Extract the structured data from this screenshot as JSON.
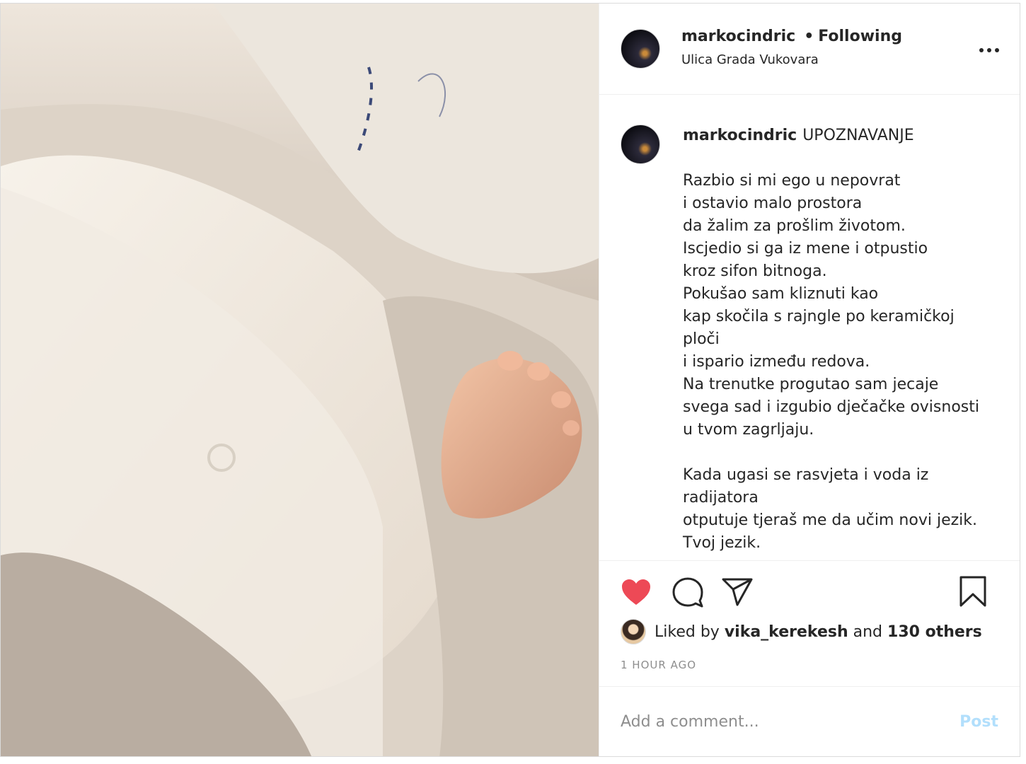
{
  "header": {
    "username": "markocindric",
    "separator": "•",
    "follow_status": "Following",
    "location": "Ulica Grada Vukovara",
    "more_icon": "more-horizontal-icon"
  },
  "caption": {
    "username": "markocindric",
    "title": "UPOZNAVANJE",
    "poem": "Razbio si mi ego u nepovrat\ni ostavio malo prostora\nda žalim za prošlim životom.\nIscjedio si ga iz mene i otpustio\nkroz sifon bitnoga.\nPokušao sam kliznuti kao\nkap skočila s rajngle po keramičkoj\nploči\ni ispario između redova.\nNa trenutke progutao sam jecaje\nsvega sad i izgubio dječačke ovisnosti\nu tvom zagrljaju.\n\nKada ugasi se rasvjeta i voda iz\nradijatora\notputuje tjeraš me da učim novi jezik.\nTvoj jezik."
  },
  "actions": {
    "liked_prefix": "Liked by",
    "liked_user": "vika_kerekesh",
    "liked_and": "and",
    "liked_others": "130 others",
    "time": "1 HOUR AGO",
    "like_color": "#ed4956"
  },
  "comment": {
    "placeholder": "Add a comment...",
    "post_label": "Post",
    "post_color": "#b2dffc"
  }
}
